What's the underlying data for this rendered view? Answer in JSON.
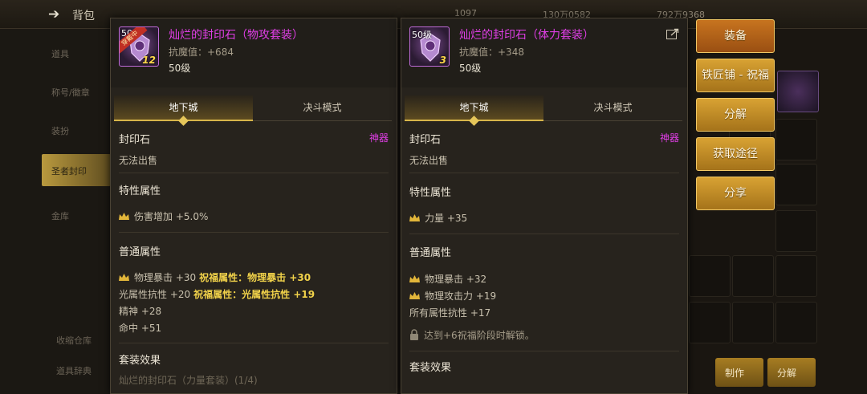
{
  "background": {
    "title": "背包",
    "currencies": [
      "1097",
      "130万0582",
      "792万9368"
    ],
    "side_items": [
      "道具",
      "称号/徽章",
      "装扮",
      "圣者封印",
      "金库"
    ],
    "bottom_items": [
      "收缩仓库",
      "道具辞典"
    ],
    "bottom_buttons": [
      "制作",
      "分解"
    ]
  },
  "left_panel": {
    "name": "灿烂的封印石（物攻套装）",
    "resist": "抗魔值：+684",
    "level": "50级",
    "icon_badge": "50",
    "icon_ribbon": "穿戴中",
    "icon_count": "12",
    "tabs": [
      "地下城",
      "决斗模式"
    ],
    "category": "封印石",
    "rarity": "神器",
    "sell": "无法出售",
    "special_title": "特性属性",
    "special_attrs": [
      "伤害增加 +5.0%"
    ],
    "normal_title": "普通属性",
    "normal_attrs": [
      {
        "crown": true,
        "text": "物理暴击 +30",
        "bless": "祝福属性：物理暴击 +30"
      },
      {
        "crown": false,
        "text": "光属性抗性 +20",
        "bless": "祝福属性：光属性抗性 +19"
      },
      {
        "crown": false,
        "text": "精神 +28",
        "bless": ""
      },
      {
        "crown": false,
        "text": "命中 +51",
        "bless": ""
      }
    ],
    "set_title": "套装效果",
    "set_line": "灿烂的封印石（力量套装）(1/4)"
  },
  "right_panel": {
    "name": "灿烂的封印石（体力套装）",
    "resist": "抗魔值：+348",
    "level": "50级",
    "icon_badge": "50级",
    "icon_count": "3",
    "tabs": [
      "地下城",
      "决斗模式"
    ],
    "category": "封印石",
    "rarity": "神器",
    "sell": "无法出售",
    "special_title": "特性属性",
    "special_attrs": [
      "力量 +35"
    ],
    "normal_title": "普通属性",
    "normal_attrs": [
      {
        "crown": true,
        "text": "物理暴击 +32"
      },
      {
        "crown": true,
        "text": "物理攻击力 +19"
      },
      {
        "crown": false,
        "text": "所有属性抗性 +17"
      }
    ],
    "lock_text": "达到+6祝福阶段时解锁。",
    "set_title": "套装效果"
  },
  "actions": [
    "装备",
    "铁匠铺 - 祝福",
    "分解",
    "获取途径",
    "分享"
  ],
  "colors": {
    "epic_purple": "#e03ee6",
    "bless_gold": "#f1d24a",
    "button_gold": "#d8a233"
  }
}
